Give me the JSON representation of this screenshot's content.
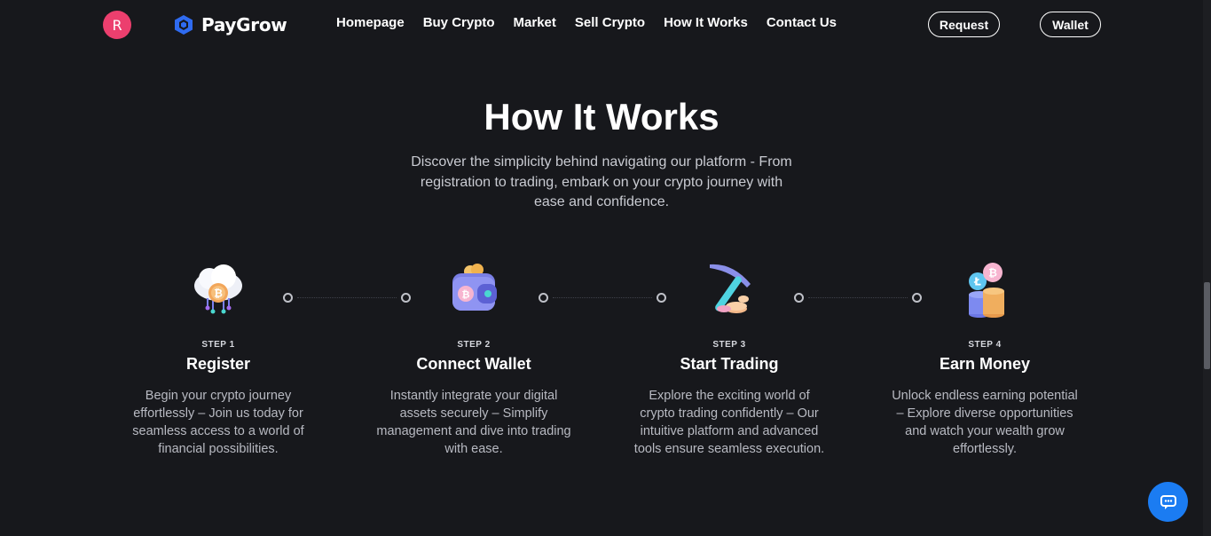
{
  "header": {
    "avatar_letter": "R",
    "brand": "PayGrow",
    "nav": [
      {
        "label": "Homepage"
      },
      {
        "label": "Buy Crypto"
      },
      {
        "label": "Market"
      },
      {
        "label": "Sell Crypto"
      },
      {
        "label": "How It Works"
      },
      {
        "label": "Contact Us"
      }
    ],
    "request_label": "Request",
    "wallet_label": "Wallet"
  },
  "hero": {
    "title": "How It Works",
    "subtitle": "Discover the simplicity behind navigating our platform - From registration to trading, embark on your crypto journey with ease and confidence."
  },
  "steps": [
    {
      "num": "STEP 1",
      "title": "Register",
      "desc": "Begin your crypto journey effortlessly – Join us today for seamless access to a world of financial possibilities.",
      "icon": "cloud-bitcoin-icon"
    },
    {
      "num": "STEP 2",
      "title": "Connect Wallet",
      "desc": "Instantly integrate your digital assets securely – Simplify management and dive into trading with ease.",
      "icon": "wallet-icon"
    },
    {
      "num": "STEP 3",
      "title": "Start Trading",
      "desc": "Explore the exciting world of crypto trading confidently – Our intuitive platform and advanced tools ensure seamless execution.",
      "icon": "pickaxe-coins-icon"
    },
    {
      "num": "STEP 4",
      "title": "Earn Money",
      "desc": "Unlock endless earning potential – Explore diverse opportunities and watch your wealth grow effortlessly.",
      "icon": "coin-stack-icon"
    }
  ],
  "colors": {
    "background": "#17181c",
    "avatar": "#ec3f6e",
    "brand_blue": "#2f6bf0",
    "chat": "#1b7cf2"
  }
}
